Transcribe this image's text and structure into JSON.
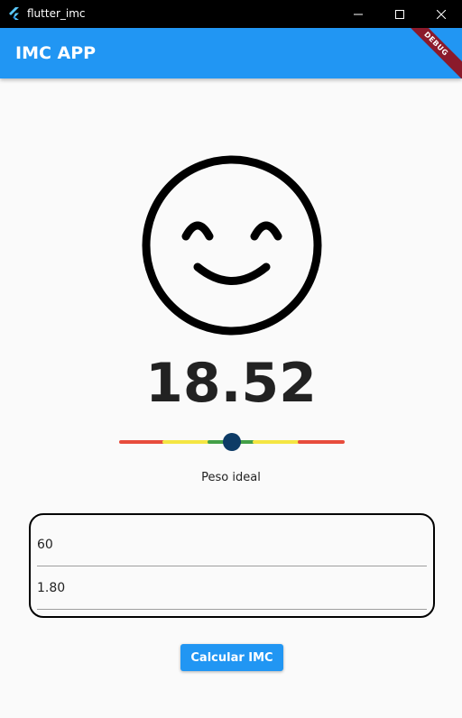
{
  "window": {
    "title": "flutter_imc",
    "logo_icon": "flutter-logo-icon",
    "minimize_icon": "minimize-icon",
    "maximize_icon": "maximize-icon",
    "close_icon": "close-icon"
  },
  "appbar": {
    "title": "IMC APP",
    "color": "#2196f3",
    "debug_banner": "DEBUG"
  },
  "result": {
    "face_icon": "smiling-face-icon",
    "imc_value": "18.52",
    "status": "Peso ideal",
    "gauge_level": 0.5,
    "gauge_colors": [
      "#e74c3c",
      "#f4e542",
      "#43a047",
      "#f4e542",
      "#e74c3c"
    ],
    "marker_color": "#0d3b66"
  },
  "form": {
    "weight_value": "60",
    "height_value": "1.80"
  },
  "actions": {
    "calculate_label": "Calcular IMC"
  }
}
